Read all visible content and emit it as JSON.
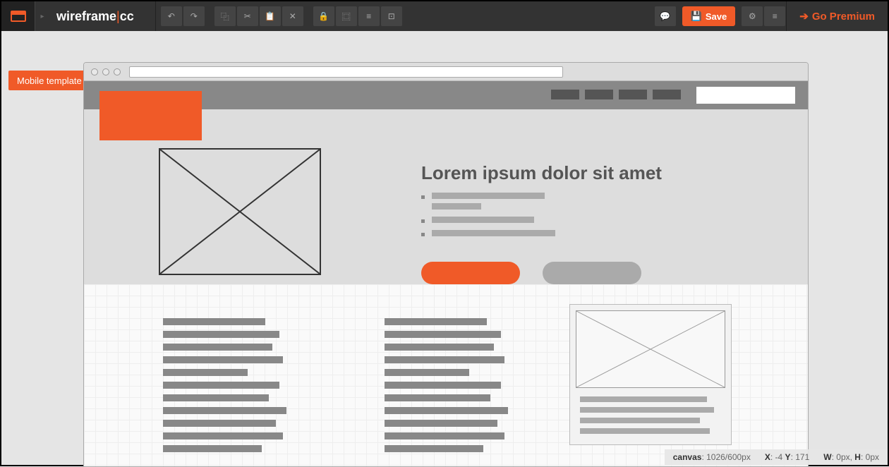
{
  "brand": {
    "name": "wireframe",
    "suffix": "cc"
  },
  "toolbar": {
    "save_label": "Save",
    "premium_label": "Go Premium",
    "icons": {
      "undo": "↶",
      "redo": "↷",
      "copy": "⿻",
      "cut": "✂",
      "paste": "📋",
      "delete": "✕",
      "lock": "🔒",
      "group": "⿴",
      "align1": "≡",
      "align2": "⊡",
      "chat": "💬",
      "share": "⚙",
      "menu": "≡"
    }
  },
  "template_tag": "Mobile template example",
  "mockup": {
    "headline": "Lorem ipsum dolor sit amet"
  },
  "status": {
    "canvas_label": "canvas",
    "canvas_value": "1026/600px",
    "x_label": "X",
    "x_value": "-4",
    "y_label": "Y",
    "y_value": "171",
    "w_label": "W",
    "w_value": "0px",
    "h_label": "H",
    "h_value": "0px"
  }
}
